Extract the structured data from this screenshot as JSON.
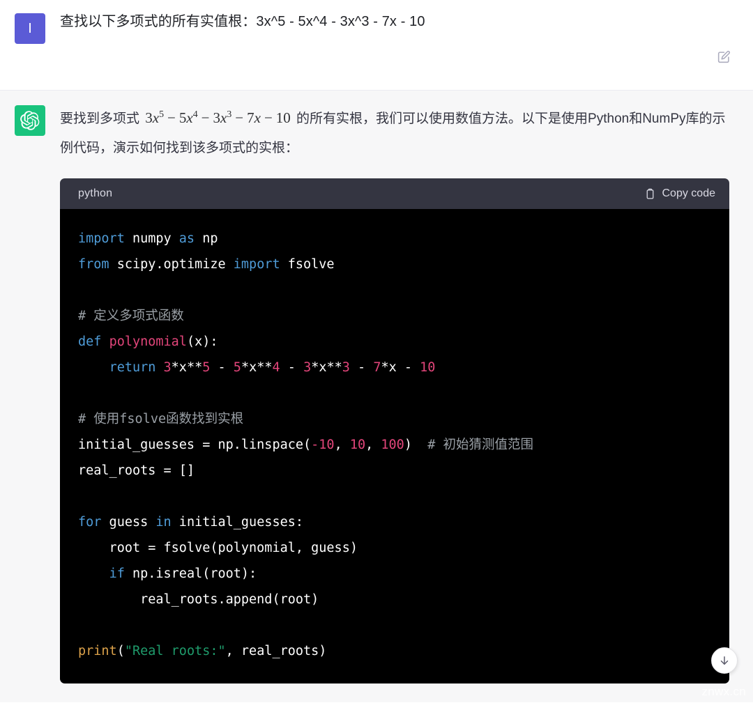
{
  "conversation": {
    "user_message": {
      "avatar_letter": "I",
      "avatar_color": "#5b5bd6",
      "text": "查找以下多项式的所有实值根：3x^5 - 5x^4 - 3x^3 - 7x - 10",
      "edit_icon": "edit-pencil-square-icon"
    },
    "assistant_message": {
      "avatar_icon": "openai-logo-icon",
      "avatar_color": "#19c37d",
      "paragraph_before_math": "要找到多项式 ",
      "math_expression": {
        "terms": [
          {
            "coef": "3",
            "var": "x",
            "exp": "5"
          },
          {
            "op": "−",
            "coef": "5",
            "var": "x",
            "exp": "4"
          },
          {
            "op": "−",
            "coef": "3",
            "var": "x",
            "exp": "3"
          },
          {
            "op": "−",
            "coef": "7",
            "var": "x",
            "exp": ""
          },
          {
            "op": "−",
            "coef": "10",
            "var": "",
            "exp": ""
          }
        ],
        "plain": "3x^5 − 5x^4 − 3x^3 − 7x − 10"
      },
      "paragraph_after_math": " 的所有实根，我们可以使用数值方法。以下是使用Python和NumPy库的示例代码，演示如何找到该多项式的实根："
    },
    "code_block": {
      "language_label": "python",
      "copy_label": "Copy code",
      "copy_icon": "clipboard-icon",
      "background": "#000000",
      "header_background": "#343541",
      "lines": [
        [
          {
            "t": "import",
            "c": "kw"
          },
          {
            "t": " numpy ",
            "c": "pl"
          },
          {
            "t": "as",
            "c": "kw"
          },
          {
            "t": " np",
            "c": "pl"
          }
        ],
        [
          {
            "t": "from",
            "c": "kw"
          },
          {
            "t": " scipy.optimize ",
            "c": "pl"
          },
          {
            "t": "import",
            "c": "kw"
          },
          {
            "t": " fsolve",
            "c": "pl"
          }
        ],
        [],
        [
          {
            "t": "# 定义多项式函数",
            "c": "com"
          }
        ],
        [
          {
            "t": "def",
            "c": "kw"
          },
          {
            "t": " ",
            "c": "pl"
          },
          {
            "t": "polynomial",
            "c": "fn"
          },
          {
            "t": "(x):",
            "c": "pl"
          }
        ],
        [
          {
            "t": "    ",
            "c": "pl"
          },
          {
            "t": "return",
            "c": "kw"
          },
          {
            "t": " ",
            "c": "pl"
          },
          {
            "t": "3",
            "c": "num"
          },
          {
            "t": "*x**",
            "c": "pl"
          },
          {
            "t": "5",
            "c": "num"
          },
          {
            "t": " - ",
            "c": "pl"
          },
          {
            "t": "5",
            "c": "num"
          },
          {
            "t": "*x**",
            "c": "pl"
          },
          {
            "t": "4",
            "c": "num"
          },
          {
            "t": " - ",
            "c": "pl"
          },
          {
            "t": "3",
            "c": "num"
          },
          {
            "t": "*x**",
            "c": "pl"
          },
          {
            "t": "3",
            "c": "num"
          },
          {
            "t": " - ",
            "c": "pl"
          },
          {
            "t": "7",
            "c": "num"
          },
          {
            "t": "*x",
            "c": "pl"
          },
          {
            "t": " - ",
            "c": "pl"
          },
          {
            "t": "10",
            "c": "num"
          }
        ],
        [],
        [
          {
            "t": "# 使用fsolve函数找到实根",
            "c": "com"
          }
        ],
        [
          {
            "t": "initial_guesses = np.linspace(",
            "c": "pl"
          },
          {
            "t": "-10",
            "c": "num"
          },
          {
            "t": ", ",
            "c": "pl"
          },
          {
            "t": "10",
            "c": "num"
          },
          {
            "t": ", ",
            "c": "pl"
          },
          {
            "t": "100",
            "c": "num"
          },
          {
            "t": ")",
            "c": "pl"
          },
          {
            "t": "  ",
            "c": "pl"
          },
          {
            "t": "# 初始猜测值范围",
            "c": "com"
          }
        ],
        [
          {
            "t": "real_roots = []",
            "c": "pl"
          }
        ],
        [],
        [
          {
            "t": "for",
            "c": "kw"
          },
          {
            "t": " guess ",
            "c": "pl"
          },
          {
            "t": "in",
            "c": "kw"
          },
          {
            "t": " initial_guesses:",
            "c": "pl"
          }
        ],
        [
          {
            "t": "    root = fsolve(polynomial, guess)",
            "c": "pl"
          }
        ],
        [
          {
            "t": "    ",
            "c": "pl"
          },
          {
            "t": "if",
            "c": "kw"
          },
          {
            "t": " np.isreal(root):",
            "c": "pl"
          }
        ],
        [
          {
            "t": "        real_roots.append(root)",
            "c": "pl"
          }
        ],
        [],
        [
          {
            "t": "print",
            "c": "bi"
          },
          {
            "t": "(",
            "c": "pl"
          },
          {
            "t": "\"Real roots:\"",
            "c": "str"
          },
          {
            "t": ", real_roots)",
            "c": "pl"
          }
        ]
      ]
    },
    "scroll_to_bottom_button": {
      "icon": "arrow-down-icon"
    },
    "watermark": "znwx.cn"
  }
}
